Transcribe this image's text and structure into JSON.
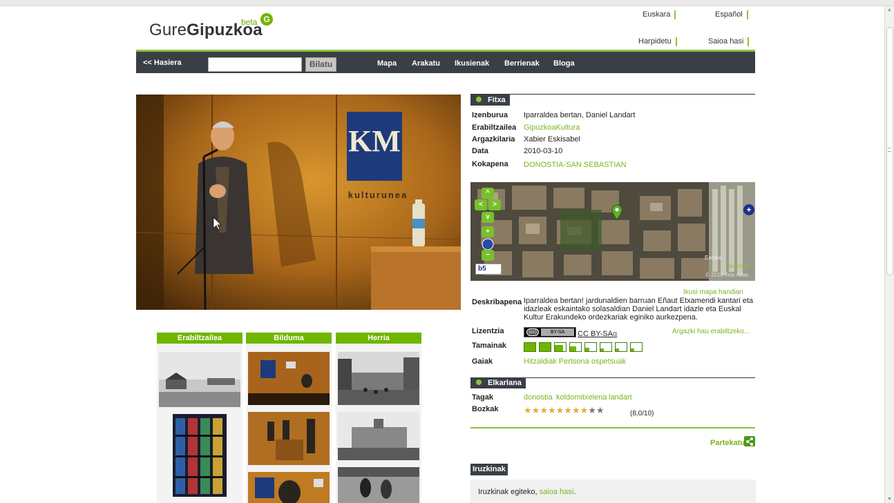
{
  "header": {
    "logo_regular": "Gure",
    "logo_bold": "Gipuzkoa",
    "logo_beta": "beta",
    "logo_badge": "G",
    "lang_links": [
      "Euskara",
      "Español"
    ],
    "account_links": [
      "Harpidetu",
      "Saioa hasi"
    ]
  },
  "nav": {
    "home": "<< Hasiera",
    "search_placeholder": "",
    "search_button": "Bilatu",
    "links": [
      "Mapa",
      "Arakatu",
      "Ikusienak",
      "Berrienak",
      "Bloga"
    ]
  },
  "columns": {
    "headers": [
      "Erabiltzailea",
      "Bilduma",
      "Herria"
    ]
  },
  "fitxa": {
    "title": "Fitxa",
    "rows": [
      {
        "label": "Izenburua",
        "value": "Iparraldea bertan, Daniel Landart"
      },
      {
        "label": "Erabiltzailea",
        "value": "GipuzkoaKultura"
      },
      {
        "label": "Argazkilaria",
        "value": "Xabier Eskisabel"
      },
      {
        "label": "Data",
        "value": "2010-03-10"
      },
      {
        "label": "Kokapena",
        "value": "DONOSTIA-SAN SEBASTIAN"
      }
    ],
    "map_link": "Ikusi mapa handian",
    "map_controls": [
      "^",
      "<",
      ">",
      "v",
      "+",
      "−"
    ],
    "map_logo": "b5",
    "map_attrib": [
      "Escala",
      "Terminos",
      "© 2010 Tele Atlas"
    ],
    "description_label": "Deskribapena",
    "description": "Iparraldea bertan! jardunaldien barruan Eñaut Etxamendi kantari eta idazleak eskaintako solasaldian Daniel Landart idazle eta Euskal Kultur Erakundeko ordezkariak eginiko aurkezpena.",
    "license_label": "Lizentzia",
    "license_badge_c": "(cc)",
    "license_badge_t": "BY-SA",
    "license_text": "CC BY-SA",
    "license_use_link": "Argazki hau erabiltzeko...",
    "sizes_label": "Tamainak",
    "sizes": [
      1.0,
      1.0,
      0.75,
      0.55,
      0.4,
      0.3,
      0.3,
      0.3
    ],
    "themes_label": "Gaiak",
    "themes": "Hitzaldiak Pertsona ospetsuak"
  },
  "elkarlana": {
    "title": "Elkarlana",
    "tags_label": "Tagak",
    "tags": [
      "donostia",
      "koldomitxelena",
      "landart"
    ],
    "votes_label": "Bozkak",
    "rating": 8,
    "rating_max": 10,
    "rating_text": "(8,0/10)",
    "share": "Partekatu"
  },
  "comments": {
    "title": "Iruzkinak",
    "prompt": "Iruzkinak egiteko, ",
    "login_link": "saioa hasi",
    "suffix": "."
  },
  "colors": {
    "accent": "#7ab51d",
    "nav_bg": "#3a3f45"
  }
}
